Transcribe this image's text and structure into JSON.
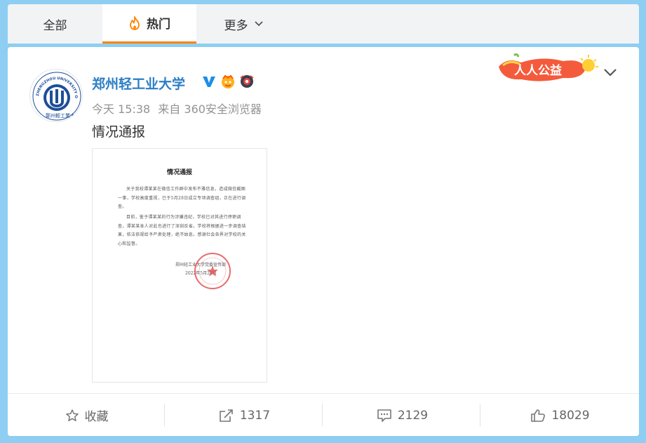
{
  "tabs": {
    "all_label": "全部",
    "hot_label": "热门",
    "more_label": "更多"
  },
  "post": {
    "username": "郑州轻工业大学",
    "meta_time": "今天 15:38",
    "meta_source": "来自 360安全浏览器",
    "text": "情况通报",
    "badge_label": "人人公益",
    "avatar_caption": "ZHENGZHOU UNIVERSITY OF LIGHT INDUSTRY",
    "document": {
      "title": "情况通报",
      "para1": "关于我校谭某某在微信工作群中发布不雅信息，造成微信截图一事，学校高度重视，已于5月28日成立专项调查组，正在进行调查。",
      "para2": "目前，鉴于谭某某的行为涉嫌违纪，学校已对其进行停职调查，谭某某本人对此也进行了深刻反省。学校将根据进一步调查结果，依法依规给予严肃处理，绝不姑息。感谢社会各界对学校的关心和监督。",
      "signature": "郑州轻工业大学党委宣传部",
      "date": "2022年5月28日"
    }
  },
  "actions": {
    "favorite_label": "收藏",
    "repost_count": "1317",
    "comment_count": "2129",
    "like_count": "18029"
  },
  "colors": {
    "accent": "#ff8200",
    "username": "#2b7ec6",
    "background": "#8dcef2"
  }
}
